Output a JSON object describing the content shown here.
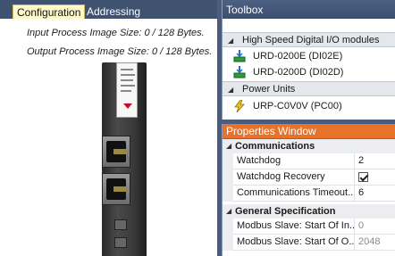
{
  "tabs": {
    "configuration": "Configuration",
    "addressing": "Addressing"
  },
  "info": {
    "input_size": "Input Process Image Size: 0 / 128 Bytes.",
    "output_size": "Output Process Image Size: 0 / 128 Bytes."
  },
  "toolbox": {
    "title": "Toolbox",
    "groups": [
      {
        "label": "High Speed Digital I/O modules",
        "items": [
          {
            "label": "URD-0200E (DI02E)",
            "icon": "digital-io-module-icon"
          },
          {
            "label": "URD-0200D (DI02D)",
            "icon": "digital-io-module-icon"
          }
        ]
      },
      {
        "label": "Power Units",
        "items": [
          {
            "label": "URP-C0V0V (PC00)",
            "icon": "power-unit-icon"
          }
        ]
      }
    ]
  },
  "properties": {
    "title": "Properties Window",
    "categories": [
      {
        "label": "Communications",
        "rows": [
          {
            "name": "Watchdog",
            "value": "2"
          },
          {
            "name": "Watchdog Recovery",
            "value": true
          },
          {
            "name": "Communications Timeout...",
            "value": "6"
          }
        ]
      },
      {
        "label": "General Specification",
        "rows": [
          {
            "name": "Modbus Slave: Start Of In...",
            "value": "0"
          },
          {
            "name": "Modbus Slave: Start Of O...",
            "value": "2048"
          }
        ]
      }
    ]
  },
  "colors": {
    "pane_header": "#3f5371",
    "active_tab": "#fff8c9",
    "properties_header": "#e8722a",
    "category_bg": "#ebedf0"
  }
}
